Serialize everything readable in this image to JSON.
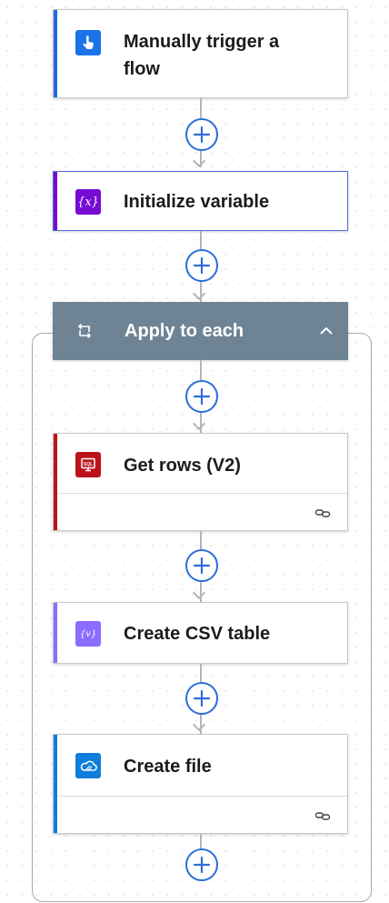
{
  "flow": {
    "trigger": {
      "title": "Manually trigger a flow",
      "accent": "#2266e3",
      "icon": "hand-pointer-icon",
      "icon_bg": "#1a73e8"
    },
    "init_variable": {
      "title": "Initialize variable",
      "accent": "#770bd6",
      "icon": "variable-icon",
      "icon_glyph": "{x}",
      "icon_bg": "#770bd6"
    },
    "apply_to_each": {
      "title": "Apply to each",
      "header_bg": "#6e8495",
      "icon": "loop-icon"
    },
    "get_rows": {
      "title": "Get rows (V2)",
      "accent": "#ba141a",
      "icon": "sql-server-icon",
      "icon_glyph": "SQL",
      "icon_bg": "#ba141a"
    },
    "create_csv": {
      "title": "Create CSV table",
      "accent": "#8c6cff",
      "icon": "data-operation-icon",
      "icon_glyph": "{v}",
      "icon_bg": "#8c6cff"
    },
    "create_file": {
      "title": "Create file",
      "accent": "#0f7dd9",
      "icon": "onedrive-icon",
      "icon_bg": "#0f7dd9"
    }
  },
  "colors": {
    "connector": "#b5b5b5",
    "add_button": "#2b6ed8",
    "card_border": "#c8c8c8"
  }
}
